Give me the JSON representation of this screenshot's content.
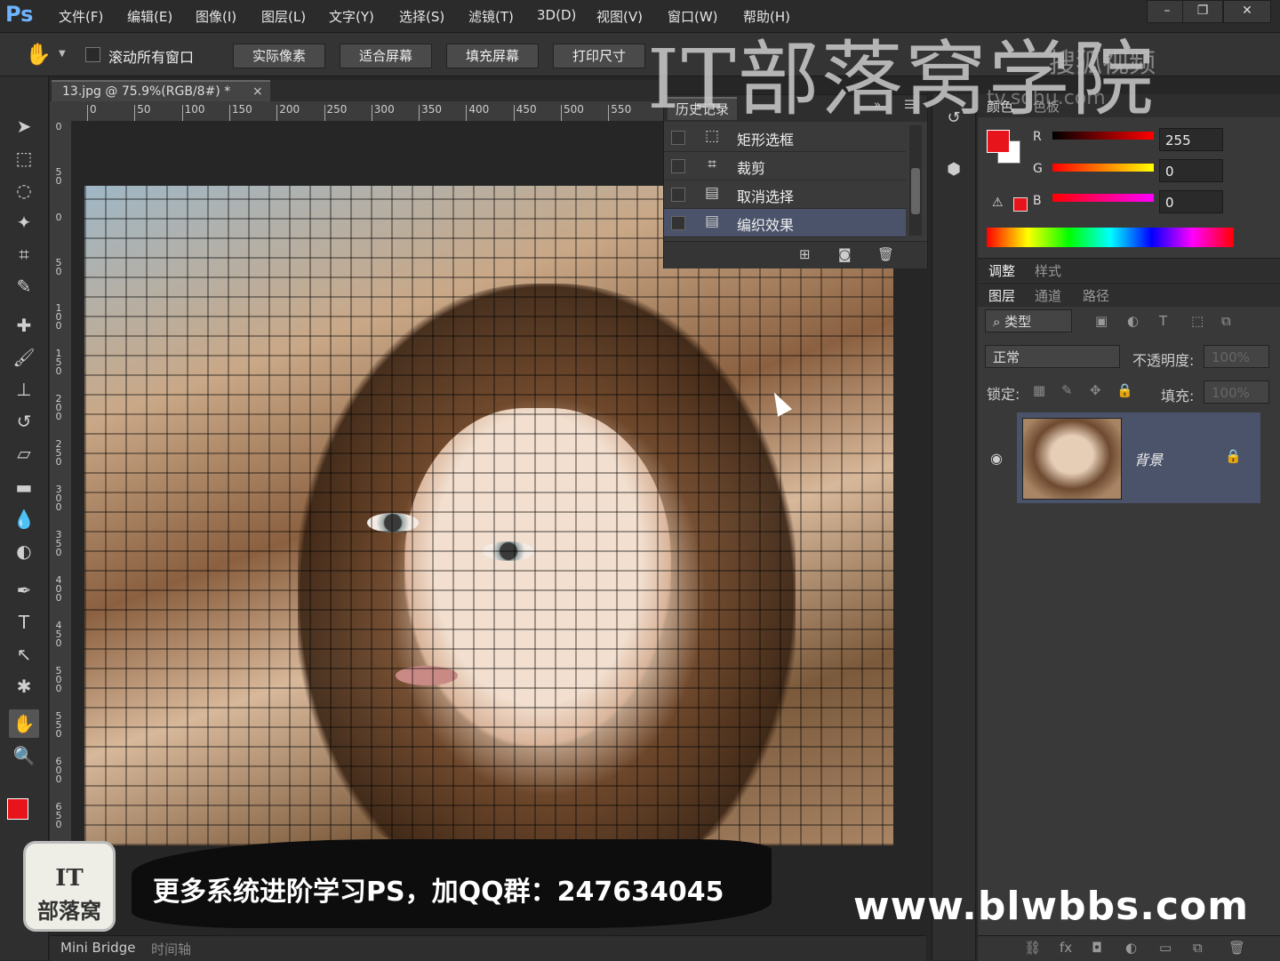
{
  "app": {
    "logo": "Ps"
  },
  "menu": [
    "文件(F)",
    "编辑(E)",
    "图像(I)",
    "图层(L)",
    "文字(Y)",
    "选择(S)",
    "滤镜(T)",
    "3D(D)",
    "视图(V)",
    "窗口(W)",
    "帮助(H)"
  ],
  "options": {
    "scroll_all_label": "滚动所有窗口",
    "buttons": [
      "实际像素",
      "适合屏幕",
      "填充屏幕",
      "打印尺寸"
    ]
  },
  "document": {
    "tab_title": "13.jpg @ 75.9%(RGB/8#) *",
    "ruler_h": [
      "0",
      "50",
      "100",
      "150",
      "200",
      "250",
      "300",
      "350",
      "400",
      "450",
      "500",
      "550"
    ],
    "ruler_v": [
      "0",
      "50",
      "0",
      "50",
      "100",
      "150",
      "200",
      "250",
      "300",
      "350",
      "400",
      "450",
      "500",
      "550",
      "600",
      "650"
    ]
  },
  "history": {
    "title": "历史记录",
    "items": [
      {
        "label": "矩形选框",
        "icon": "marquee-icon"
      },
      {
        "label": "裁剪",
        "icon": "crop-icon"
      },
      {
        "label": "取消选择",
        "icon": "document-icon"
      },
      {
        "label": "编织效果",
        "icon": "document-icon"
      }
    ],
    "selected_index": 3
  },
  "color": {
    "tabs": [
      "颜色",
      "色板"
    ],
    "foreground": "#e8141b",
    "channels": [
      {
        "label": "R",
        "value": "255"
      },
      {
        "label": "G",
        "value": "0"
      },
      {
        "label": "B",
        "value": "0"
      }
    ]
  },
  "adjust_tabs": [
    "调整",
    "样式"
  ],
  "layers": {
    "tabs": [
      "图层",
      "通道",
      "路径"
    ],
    "filter_label": "类型",
    "blend_mode": "正常",
    "opacity_label": "不透明度:",
    "opacity_value": "100%",
    "lock_label": "锁定:",
    "fill_label": "填充:",
    "fill_value": "100%",
    "layer_name": "背景"
  },
  "bottom_tabs": [
    "Mini Bridge",
    "时间轴"
  ],
  "overlay": {
    "watermark": "IT部落窝学院",
    "watermark_small": "搜狐视频",
    "watermark_url": "tv.sohu.com",
    "banner": "更多系统进阶学习PS，加QQ群：247634045",
    "site_url": "www.blwbbs.com",
    "logo_line1": "IT",
    "logo_line2": "部落窝"
  }
}
